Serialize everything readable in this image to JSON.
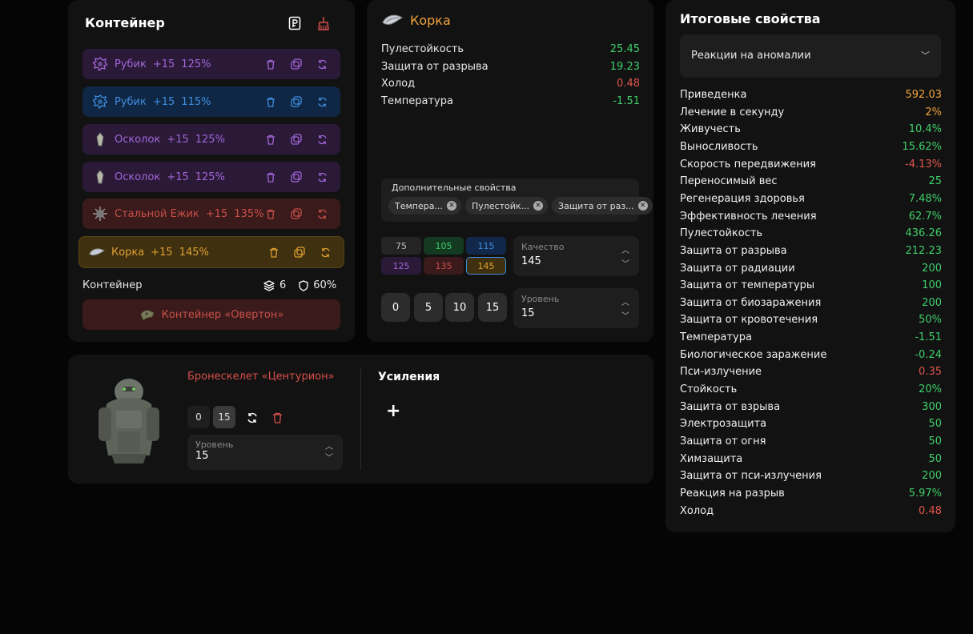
{
  "container_panel": {
    "title": "Контейнер",
    "slots": [
      {
        "name": "Рубик",
        "plus": "+15",
        "percent": "125%",
        "color": "purple"
      },
      {
        "name": "Рубик",
        "plus": "+15",
        "percent": "115%",
        "color": "blue"
      },
      {
        "name": "Осколок",
        "plus": "+15",
        "percent": "125%",
        "color": "purple"
      },
      {
        "name": "Осколок",
        "plus": "+15",
        "percent": "125%",
        "color": "purple"
      },
      {
        "name": "Стальной Ежик",
        "plus": "+15",
        "percent": "135%",
        "color": "red"
      },
      {
        "name": "Корка",
        "plus": "+15",
        "percent": "145%",
        "color": "gold"
      }
    ],
    "footer_label": "Контейнер",
    "capacity": "6",
    "protection": "60%",
    "container_name": "Контейнер «Овертон»"
  },
  "artifact_panel": {
    "title": "Корка",
    "stats": [
      {
        "name": "Пулестойкость",
        "value": "25.45",
        "color": "#3fcf6a"
      },
      {
        "name": "Защита от разрыва",
        "value": "19.23",
        "color": "#3fcf6a"
      },
      {
        "name": "Холод",
        "value": "0.48",
        "color": "#e0554d"
      },
      {
        "name": "Температура",
        "value": "-1.51",
        "color": "#3fcf6a"
      }
    ],
    "extra_title": "Дополнительные свойства",
    "extra_chips": [
      "Темпера...",
      "Пулестойк...",
      "Защита от раз..."
    ],
    "quality_options": [
      "75",
      "105",
      "115",
      "125",
      "135",
      "145"
    ],
    "quality_label": "Качество",
    "quality_value": "145",
    "level_buttons": [
      "0",
      "5",
      "10",
      "15"
    ],
    "level_label": "Уровень",
    "level_value": "15"
  },
  "total_panel": {
    "title": "Итоговые свойства",
    "dropdown_value": "Реакции на аномалии",
    "stats": [
      {
        "name": "Приведенка",
        "value": "592.03",
        "color": "#f0a33a"
      },
      {
        "name": "Лечение в секунду",
        "value": "2%",
        "color": "#f0a33a"
      },
      {
        "name": "Живучесть",
        "value": "10.4%",
        "color": "#3fcf6a"
      },
      {
        "name": "Выносливость",
        "value": "15.62%",
        "color": "#3fcf6a"
      },
      {
        "name": "Скорость передвижения",
        "value": "-4.13%",
        "color": "#e0554d"
      },
      {
        "name": "Переносимый вес",
        "value": "25",
        "color": "#3fcf6a"
      },
      {
        "name": "Регенерация здоровья",
        "value": "7.48%",
        "color": "#3fcf6a"
      },
      {
        "name": "Эффективность лечения",
        "value": "62.7%",
        "color": "#3fcf6a"
      },
      {
        "name": "Пулестойкость",
        "value": "436.26",
        "color": "#3fcf6a"
      },
      {
        "name": "Защита от разрыва",
        "value": "212.23",
        "color": "#3fcf6a"
      },
      {
        "name": "Защита от радиации",
        "value": "200",
        "color": "#3fcf6a"
      },
      {
        "name": "Защита от температуры",
        "value": "100",
        "color": "#3fcf6a"
      },
      {
        "name": "Защита от биозаражения",
        "value": "200",
        "color": "#3fcf6a"
      },
      {
        "name": "Защита от кровотечения",
        "value": "50%",
        "color": "#3fcf6a"
      },
      {
        "name": "Температура",
        "value": "-1.51",
        "color": "#3fcf6a"
      },
      {
        "name": "Биологическое заражение",
        "value": "-0.24",
        "color": "#3fcf6a"
      },
      {
        "name": "Пси-излучение",
        "value": "0.35",
        "color": "#e0554d"
      },
      {
        "name": "Стойкость",
        "value": "20%",
        "color": "#3fcf6a"
      },
      {
        "name": "Защита от взрыва",
        "value": "300",
        "color": "#3fcf6a"
      },
      {
        "name": "Электрозащита",
        "value": "50",
        "color": "#3fcf6a"
      },
      {
        "name": "Защита от огня",
        "value": "50",
        "color": "#3fcf6a"
      },
      {
        "name": "Химзащита",
        "value": "50",
        "color": "#3fcf6a"
      },
      {
        "name": "Защита от пси-излучения",
        "value": "200",
        "color": "#3fcf6a"
      },
      {
        "name": "Реакция на разрыв",
        "value": "5.97%",
        "color": "#3fcf6a"
      },
      {
        "name": "Холод",
        "value": "0.48",
        "color": "#e0554d"
      }
    ]
  },
  "armor_panel": {
    "name": "Бронескелет «Центурион»",
    "upgrade_values": [
      "0",
      "15"
    ],
    "level_label": "Уровень",
    "level_value": "15",
    "boosts_title": "Усиления",
    "add_symbol": "+"
  }
}
